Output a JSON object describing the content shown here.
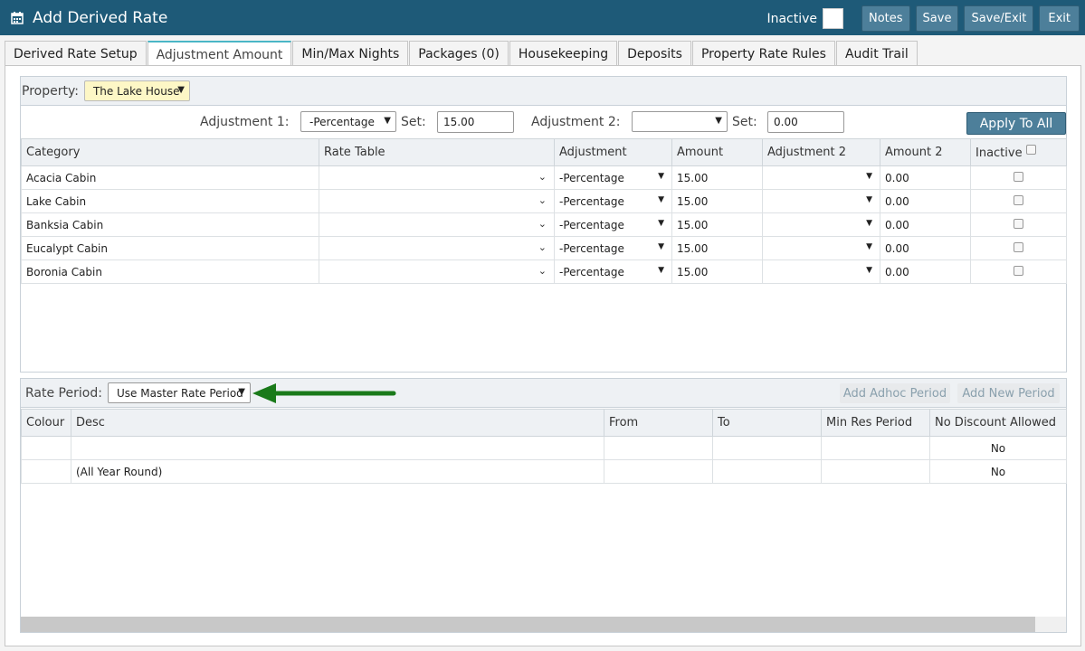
{
  "header": {
    "title": "Add Derived Rate",
    "icon": "calendar-icon",
    "inactive_label": "Inactive",
    "buttons": {
      "notes": "Notes",
      "save": "Save",
      "save_exit": "Save/Exit",
      "exit": "Exit"
    }
  },
  "tabs": [
    "Derived Rate Setup",
    "Adjustment Amount",
    "Min/Max Nights",
    "Packages (0)",
    "Housekeeping",
    "Deposits",
    "Property Rate Rules",
    "Audit Trail"
  ],
  "property": {
    "label": "Property:",
    "value": "The Lake House"
  },
  "adjustment_bar": {
    "adj1_label": "Adjustment 1:",
    "adj1_value": "-Percentage",
    "set1_label": "Set:",
    "set1_value": "15.00",
    "adj2_label": "Adjustment 2:",
    "adj2_value": "",
    "set2_label": "Set:",
    "set2_value": "0.00",
    "apply_label": "Apply To All"
  },
  "category_table": {
    "headers": [
      "Category",
      "Rate Table",
      "Adjustment",
      "Amount",
      "Adjustment 2",
      "Amount 2",
      "Inactive"
    ],
    "rows": [
      {
        "category": "Acacia Cabin",
        "rate_table": "",
        "adjustment": "-Percentage",
        "amount": "15.00",
        "adjustment2": "",
        "amount2": "0.00"
      },
      {
        "category": "Lake Cabin",
        "rate_table": "",
        "adjustment": "-Percentage",
        "amount": "15.00",
        "adjustment2": "",
        "amount2": "0.00"
      },
      {
        "category": "Banksia Cabin",
        "rate_table": "",
        "adjustment": "-Percentage",
        "amount": "15.00",
        "adjustment2": "",
        "amount2": "0.00"
      },
      {
        "category": "Eucalypt Cabin",
        "rate_table": "",
        "adjustment": "-Percentage",
        "amount": "15.00",
        "adjustment2": "",
        "amount2": "0.00"
      },
      {
        "category": "Boronia Cabin",
        "rate_table": "",
        "adjustment": "-Percentage",
        "amount": "15.00",
        "adjustment2": "",
        "amount2": "0.00"
      }
    ]
  },
  "rate_period": {
    "label": "Rate Period:",
    "value": "Use Master Rate Period",
    "add_adhoc": "Add Adhoc Period",
    "add_new": "Add New Period",
    "arrow_color": "#1a7a1a",
    "headers": [
      "Colour",
      "Desc",
      "From",
      "To",
      "Min Res Period",
      "No Discount Allowed"
    ],
    "rows": [
      {
        "colour": "",
        "desc": "",
        "from": "",
        "to": "",
        "min_res": "",
        "no_discount": "No"
      },
      {
        "colour": "",
        "desc": "(All Year Round)",
        "from": "",
        "to": "",
        "min_res": "",
        "no_discount": "No"
      }
    ]
  }
}
